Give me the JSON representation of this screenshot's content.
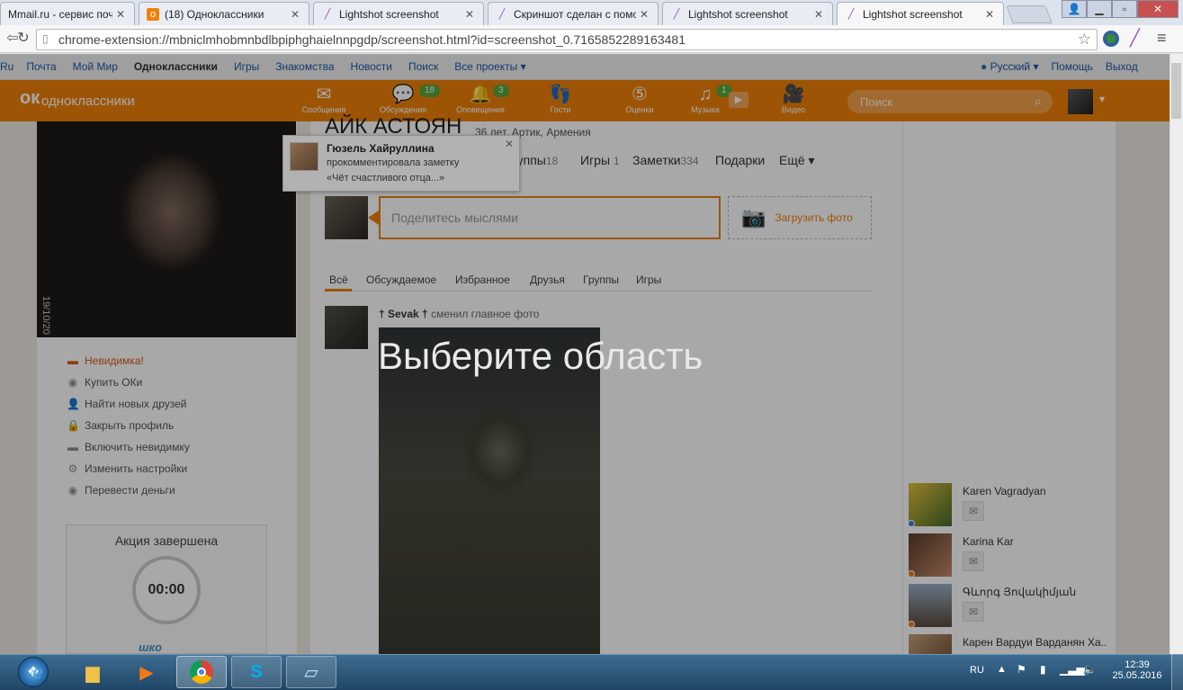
{
  "browser": {
    "tabs": [
      {
        "title": "Mmail.ru - сервис почт",
        "icon": "mail-icon"
      },
      {
        "title": "(18) Одноклассники",
        "icon": "ok-icon"
      },
      {
        "title": "Lightshot screenshot",
        "icon": "lightshot-icon"
      },
      {
        "title": "Скриншот сделан с помо",
        "icon": "lightshot-icon"
      },
      {
        "title": "Lightshot screenshot",
        "icon": "lightshot-icon"
      },
      {
        "title": "Lightshot screenshot",
        "icon": "lightshot-icon",
        "active": true
      }
    ],
    "url": "chrome-extension://mbniclmhobmnbdlbpiphghaielnnpgdp/screenshot.html?id=screenshot_0.7165852289163481"
  },
  "portal_nav": {
    "left": [
      "Ru",
      "Почта",
      "Мой Мир",
      "Одноклассники",
      "Игры",
      "Знакомства",
      "Новости",
      "Поиск",
      "Все проекты ▾"
    ],
    "right": [
      "Русский ▾",
      "Помощь",
      "Выход"
    ]
  },
  "ok_header": {
    "logo": "одноклассники",
    "nav": [
      {
        "label": "Сообщения",
        "icon": "envelope-icon",
        "badge": ""
      },
      {
        "label": "Обсуждения",
        "icon": "chat-bubbles-icon",
        "badge": "18"
      },
      {
        "label": "Оповещения",
        "icon": "bell-icon",
        "badge": "3"
      },
      {
        "label": "Гости",
        "icon": "footprints-icon",
        "badge": ""
      },
      {
        "label": "Оценки",
        "icon": "five-rating-icon",
        "badge": ""
      },
      {
        "label": "Музыка",
        "icon": "music-note-icon",
        "badge": "1"
      },
      {
        "label": "Видео",
        "icon": "video-camera-icon",
        "badge": ""
      }
    ],
    "search_placeholder": "Поиск"
  },
  "profile": {
    "name_partial": "АЙК АСТОЯН",
    "meta": "36 лет, Артик, Армения",
    "photo_caption": "19/10/20",
    "subnav": [
      {
        "label": "руппы",
        "count": "18"
      },
      {
        "label": "Игры",
        "count": "1"
      },
      {
        "label": "Заметки",
        "count": "334"
      },
      {
        "label": "Подарки",
        "count": ""
      },
      {
        "label": "Ещё ▾",
        "count": ""
      }
    ],
    "share_placeholder": "Поделитесь мыслями",
    "upload_label": "Загрузить фото"
  },
  "left_menu": [
    {
      "label": "Невидимка!",
      "icon": "hat-icon",
      "highlight": true
    },
    {
      "label": "Купить ОКи",
      "icon": "coin-icon"
    },
    {
      "label": "Найти новых друзей",
      "icon": "person-icon"
    },
    {
      "label": "Закрыть профиль",
      "icon": "lock-icon"
    },
    {
      "label": "Включить невидимку",
      "icon": "hat-icon"
    },
    {
      "label": "Изменить настройки",
      "icon": "gear-icon"
    },
    {
      "label": "Перевести деньги",
      "icon": "money-icon"
    }
  ],
  "promo": {
    "title": "Акция завершена",
    "timer": "00:00",
    "partial_text": "шко"
  },
  "feed": {
    "tabs": [
      "Всё",
      "Обсуждаемое",
      "Избранное",
      "Друзья",
      "Группы",
      "Игры"
    ],
    "active_tab": "Всё",
    "post": {
      "author": "† Sevak †",
      "action": "сменил главное фото"
    }
  },
  "notification": {
    "name": "Гюзель Хайруллина",
    "line1": "прокомментировала заметку",
    "line2": "«Чёт счастливого отца...»"
  },
  "overlay_text": "Выберите область",
  "friends": [
    {
      "name": "Karen Vagradyan",
      "status": "#2f7de1"
    },
    {
      "name": "Karina Kar",
      "status": "#f07a1a"
    },
    {
      "name": "Գևորգ Յովակիմյան",
      "status": "#f07a1a"
    },
    {
      "name": "Карен Вардуи Варданян Ха..",
      "status": ""
    }
  ],
  "taskbar": {
    "lang": "RU",
    "time": "12:39",
    "date": "25.05.2016",
    "apps": [
      "ie-icon",
      "explorer-folder-icon",
      "media-player-icon",
      "chrome-icon",
      "skype-icon",
      "notepad-icon"
    ]
  },
  "colors": {
    "ok_orange": "#ee8208",
    "link_blue": "#1f58a6",
    "badge_green": "#55a83d"
  }
}
